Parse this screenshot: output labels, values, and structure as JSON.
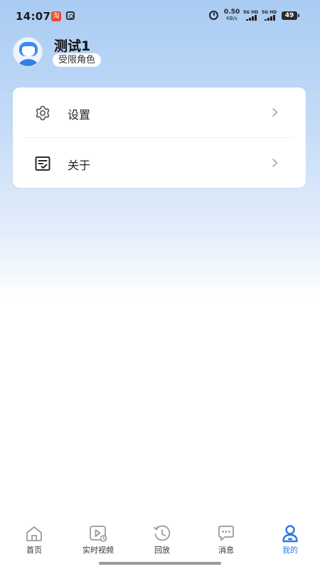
{
  "status_bar": {
    "time": "14:07",
    "app_icon_1_text": "淘",
    "net_speed_value": "0.50",
    "net_speed_unit": "KB/s",
    "signal_1_label": "5G HD",
    "signal_2_label": "5G HD",
    "battery_level": "49"
  },
  "profile": {
    "name": "测试1",
    "role": "受限角色"
  },
  "menu": {
    "items": [
      {
        "label": "设置",
        "icon": "gear-icon"
      },
      {
        "label": "关于",
        "icon": "document-check-icon"
      }
    ]
  },
  "bottom_nav": {
    "active": "我的",
    "accent_color": "#2d79e6",
    "items": [
      {
        "label": "首页",
        "icon": "home-icon"
      },
      {
        "label": "实时视频",
        "icon": "video-icon"
      },
      {
        "label": "回放",
        "icon": "playback-icon"
      },
      {
        "label": "消息",
        "icon": "message-icon"
      },
      {
        "label": "我的",
        "icon": "user-icon"
      }
    ]
  }
}
